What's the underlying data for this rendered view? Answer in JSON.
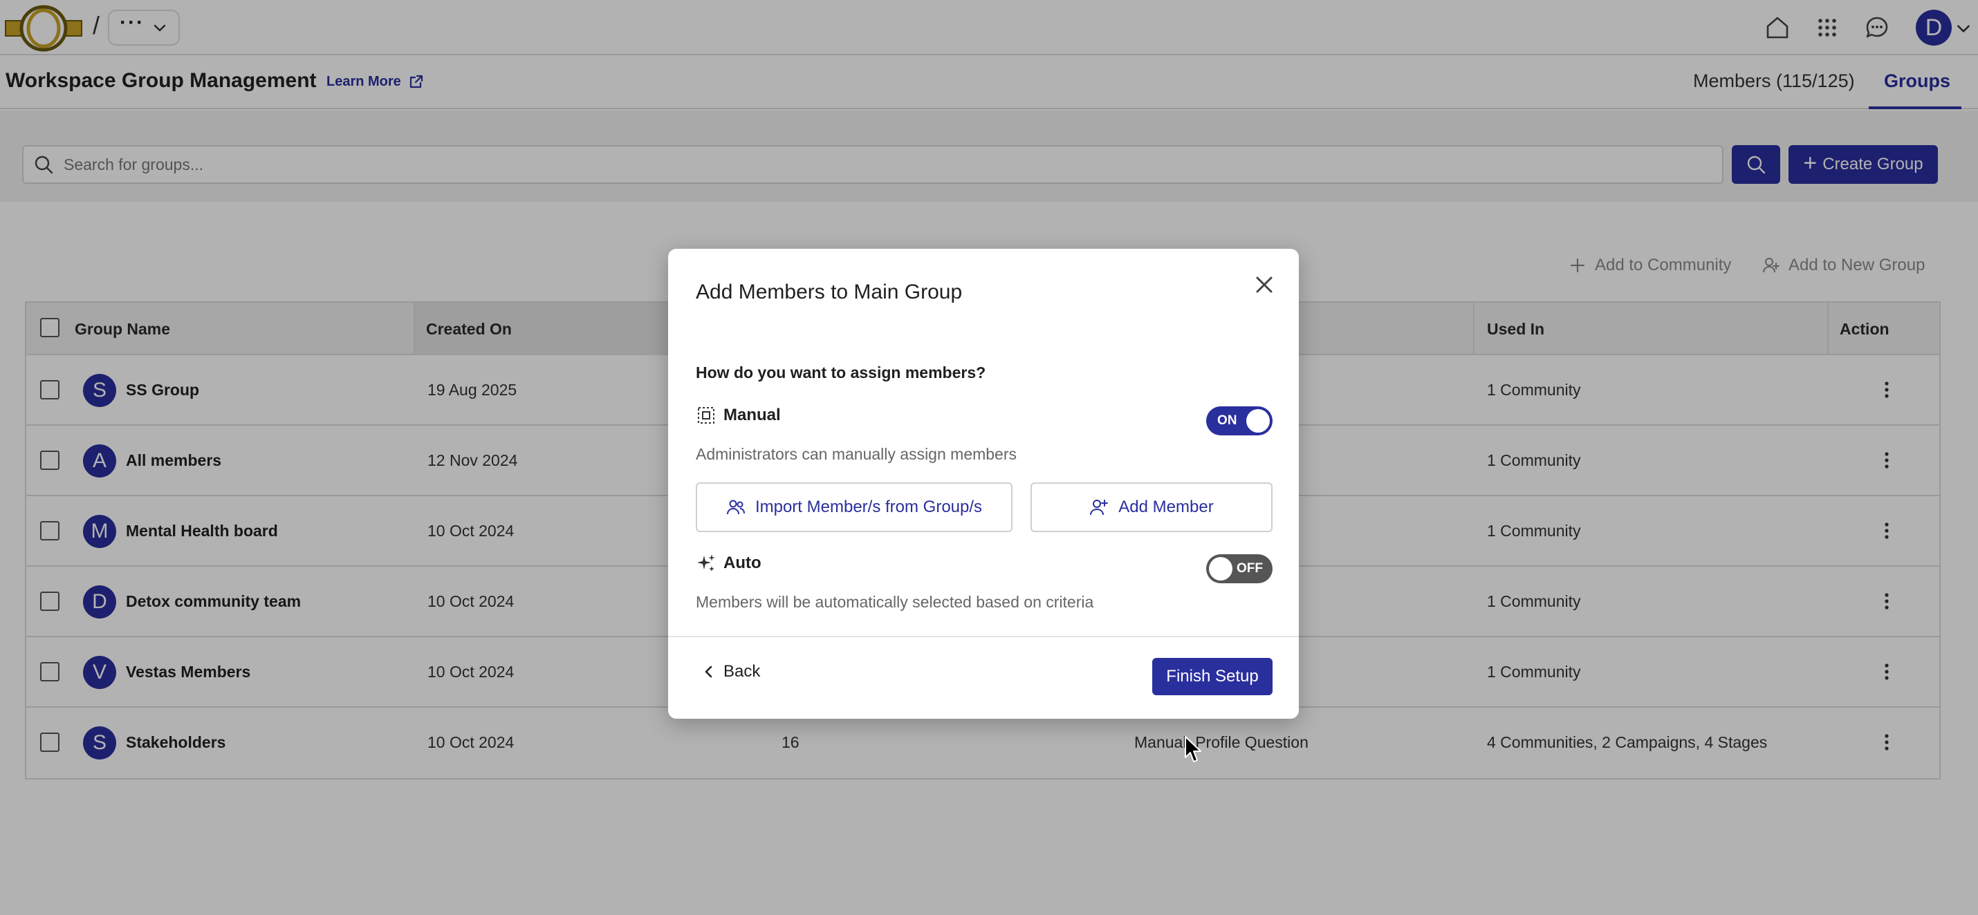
{
  "topbar": {
    "breadcrumb_separator": "/",
    "breadcrumb_more": "···",
    "user_initial": "D"
  },
  "header": {
    "title": "Workspace Group Management",
    "learn_more": "Learn More",
    "tabs": [
      {
        "label": "Members (115/125)",
        "active": false
      },
      {
        "label": "Groups",
        "active": true
      }
    ]
  },
  "search": {
    "placeholder": "Search for groups...",
    "value": "",
    "create_label": "Create Group"
  },
  "bulk_actions": {
    "add_to_community": "Add to Community",
    "add_to_new_group": "Add to New Group"
  },
  "table": {
    "columns": {
      "group_name": "Group Name",
      "created_on": "Created On",
      "used_in": "Used In",
      "action": "Action"
    },
    "rows": [
      {
        "initial": "S",
        "name": "SS Group",
        "created": "19 Aug 2025",
        "members": "",
        "type": "",
        "used_in": "1 Community"
      },
      {
        "initial": "A",
        "name": "All members",
        "created": "12 Nov 2024",
        "members": "",
        "type": "",
        "used_in": "1 Community"
      },
      {
        "initial": "M",
        "name": "Mental Health board",
        "created": "10 Oct 2024",
        "members": "",
        "type": "",
        "used_in": "1 Community"
      },
      {
        "initial": "D",
        "name": "Detox community team",
        "created": "10 Oct 2024",
        "members": "",
        "type": "",
        "used_in": "1 Community"
      },
      {
        "initial": "V",
        "name": "Vestas Members",
        "created": "10 Oct 2024",
        "members": "",
        "type": "",
        "used_in": "1 Community"
      },
      {
        "initial": "S",
        "name": "Stakeholders",
        "created": "10 Oct 2024",
        "members": "16",
        "type": "Manual, Profile Question",
        "used_in": "4 Communities, 2 Campaigns, 4 Stages"
      }
    ]
  },
  "modal": {
    "title": "Add Members to Main Group",
    "question": "How do you want to assign members?",
    "manual": {
      "label": "Manual",
      "toggle": "ON",
      "description": "Administrators can manually assign members",
      "import_button": "Import Member/s from Group/s",
      "add_button": "Add Member"
    },
    "auto": {
      "label": "Auto",
      "toggle": "OFF",
      "description": "Members will be automatically selected based on criteria"
    },
    "back": "Back",
    "finish": "Finish Setup"
  },
  "colors": {
    "primary": "#2a2f9e",
    "toggle_off": "#555555",
    "overlay": "rgba(0,0,0,0.30)"
  }
}
